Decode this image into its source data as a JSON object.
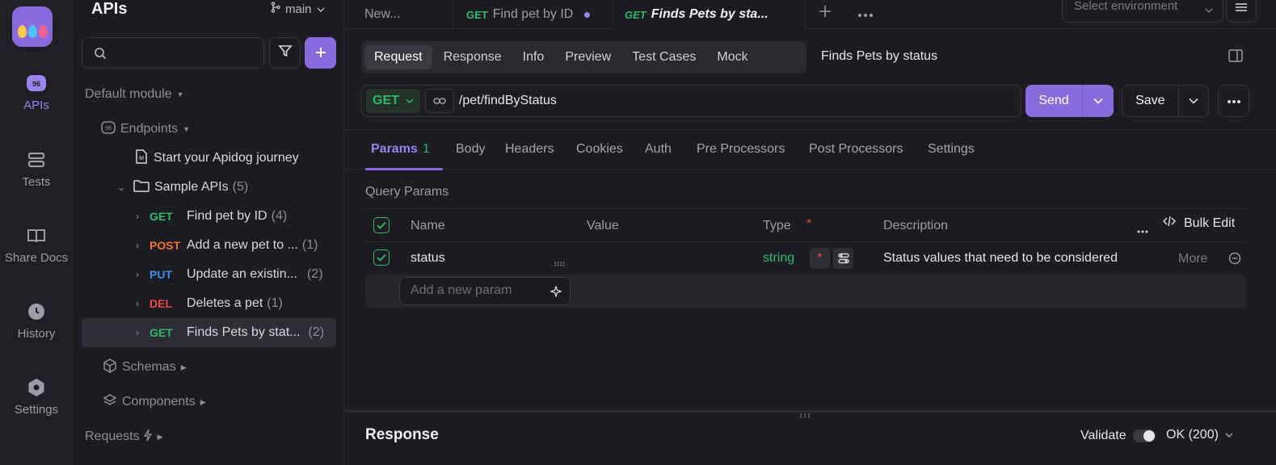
{
  "rail": {
    "items": [
      {
        "label": "APIs"
      },
      {
        "label": "Tests"
      },
      {
        "label": "Share Docs"
      },
      {
        "label": "History"
      },
      {
        "label": "Settings"
      }
    ]
  },
  "sidebar": {
    "title": "APIs",
    "branch": "main",
    "search_placeholder": "",
    "default_module": "Default module",
    "endpoints_label": "Endpoints",
    "journey": "Start your Apidog journey",
    "folder": {
      "label": "Sample APIs",
      "count": "(5)"
    },
    "apis": [
      {
        "method": "GET",
        "name": "Find pet by ID",
        "count": "(4)"
      },
      {
        "method": "POST",
        "name": "Add a new pet to ...",
        "count": "(1)"
      },
      {
        "method": "PUT",
        "name": "Update an existin...",
        "count": "(2)"
      },
      {
        "method": "DEL",
        "name": "Deletes a pet",
        "count": "(1)"
      },
      {
        "method": "GET",
        "name": "Finds Pets by stat...",
        "count": "(2)"
      }
    ],
    "schemas": "Schemas",
    "components": "Components",
    "requests": "Requests"
  },
  "tabs": {
    "new_tab": "New...",
    "tab1": {
      "method": "GET",
      "label": "Find pet by ID"
    },
    "tab2": {
      "method": "GET",
      "label": "Finds Pets by sta..."
    },
    "env_placeholder": "Select environment"
  },
  "subnav": {
    "items": [
      "Request",
      "Response",
      "Info",
      "Preview",
      "Test Cases",
      "Mock"
    ],
    "endpoint_name": "Finds Pets by status"
  },
  "request": {
    "method": "GET",
    "url": "/pet/findByStatus",
    "send": "Send",
    "save": "Save"
  },
  "param_tabs": {
    "params": "Params",
    "params_count": "1",
    "items": [
      "Body",
      "Headers",
      "Cookies",
      "Auth",
      "Pre Processors",
      "Post Processors",
      "Settings"
    ]
  },
  "query": {
    "title": "Query Params",
    "headers": {
      "name": "Name",
      "value": "Value",
      "type": "Type",
      "required_mark": "*",
      "description": "Description",
      "bulk_edit": "Bulk Edit"
    },
    "row": {
      "name": "status",
      "value": "",
      "type": "string",
      "required_mark": "*",
      "description": "Status values that need to be considered",
      "more": "More"
    },
    "new_placeholder": "Add a new param"
  },
  "response": {
    "title": "Response",
    "validate": "Validate",
    "status": "OK (200)"
  },
  "colors": {
    "accent": "#8a6bde",
    "get": "#32b86a",
    "post": "#f0742e",
    "put": "#3b8ef0",
    "delete": "#f04a3e"
  }
}
